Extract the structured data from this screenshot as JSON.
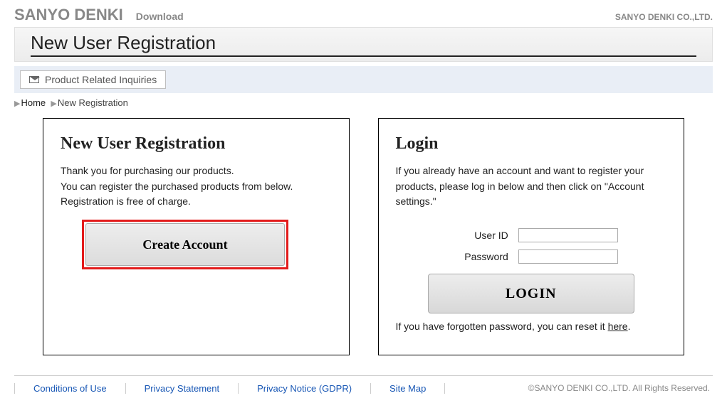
{
  "header": {
    "logo": "SANYO DENKI",
    "subtitle": "Download",
    "company": "SANYO DENKI CO.,LTD."
  },
  "page_title": "New User Registration",
  "inquiry_button": "Product Related Inquiries",
  "breadcrumb": {
    "home": "Home",
    "current": "New Registration"
  },
  "registration": {
    "heading": "New User Registration",
    "line1": "Thank you for purchasing our products.",
    "line2": "You can register the purchased products from below.",
    "line3": "Registration is free of charge.",
    "button": "Create Account"
  },
  "login": {
    "heading": "Login",
    "intro": "If you already have an account and want to register your products, please log in below and then click on \"Account settings.\"",
    "userid_label": "User ID",
    "password_label": "Password",
    "button": "LOGIN",
    "forgot_pre": "If you have forgotten password, you can reset it ",
    "forgot_link": "here",
    "forgot_post": "."
  },
  "footer": {
    "links": [
      "Conditions of Use",
      "Privacy Statement",
      "Privacy Notice (GDPR)",
      "Site Map"
    ],
    "copyright": "©SANYO DENKI CO.,LTD. All Rights Reserved."
  }
}
